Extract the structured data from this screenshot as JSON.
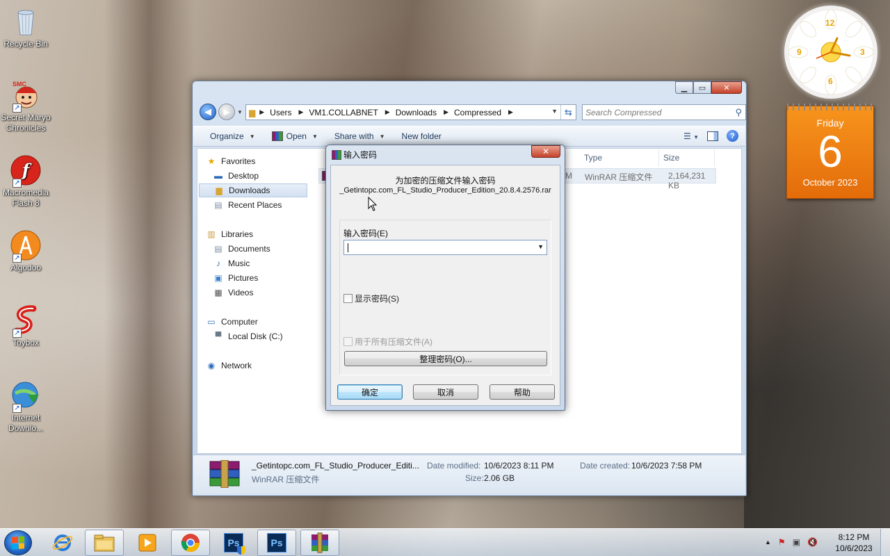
{
  "desktop": {
    "icons": [
      {
        "label": "Recycle Bin"
      },
      {
        "label": "Secret Maryo Chronicles"
      },
      {
        "label": "Macromedia Flash 8"
      },
      {
        "label": "Algodoo"
      },
      {
        "label": "Toybox"
      },
      {
        "label": "Internet Downlo..."
      }
    ],
    "smc_logo": "SMC"
  },
  "gadgets": {
    "clock_numbers": [
      "12",
      "3",
      "6",
      "9"
    ],
    "calendar": {
      "day": "Friday",
      "date": "6",
      "month": "October 2023"
    }
  },
  "explorer": {
    "breadcrumbs": [
      "Users",
      "VM1.COLLABNET",
      "Downloads",
      "Compressed"
    ],
    "search_placeholder": "Search Compressed",
    "toolbar": {
      "organize": "Organize",
      "open": "Open",
      "share_with": "Share with",
      "new_folder": "New folder"
    },
    "nav": {
      "favorites": "Favorites",
      "desktop": "Desktop",
      "downloads": "Downloads",
      "recent_places": "Recent Places",
      "libraries": "Libraries",
      "documents": "Documents",
      "music": "Music",
      "pictures": "Pictures",
      "videos": "Videos",
      "computer": "Computer",
      "local_disk": "Local Disk (C:)",
      "network": "Network"
    },
    "columns": {
      "type": "Type",
      "size": "Size"
    },
    "file_row": {
      "date_fragment": "M",
      "type": "WinRAR 压缩文件",
      "size": "2,164,231 KB"
    },
    "details": {
      "name": "_Getintopc.com_FL_Studio_Producer_Editi...",
      "type": "WinRAR 压缩文件",
      "date_modified_label": "Date modified:",
      "date_modified": "10/6/2023 8:11 PM",
      "date_created_label": "Date created:",
      "date_created": "10/6/2023 7:58 PM",
      "size_label": "Size:",
      "size": "2.06 GB"
    }
  },
  "dialog": {
    "title": "输入密码",
    "heading": "为加密的压缩文件输入密码",
    "filename": "_Getintopc.com_FL_Studio_Producer_Edition_20.8.4.2576.rar",
    "password_label": "输入密码(E)",
    "password_value": "",
    "show_password": "显示密码(S)",
    "use_for_all": "用于所有压缩文件(A)",
    "organize_passwords": "整理密码(O)...",
    "ok": "确定",
    "cancel": "取消",
    "help": "帮助"
  },
  "taskbar": {
    "time": "8:12 PM",
    "date": "10/6/2023",
    "ps_label": "Ps"
  }
}
